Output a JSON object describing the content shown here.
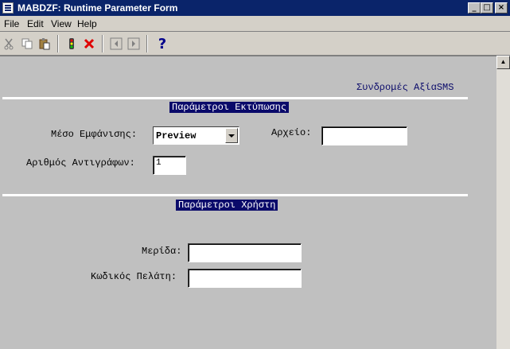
{
  "window": {
    "title": "MABDZF: Runtime Parameter Form"
  },
  "menu": {
    "file": "File",
    "edit": "Edit",
    "view": "View",
    "help": "Help"
  },
  "toolbar": {
    "help_label": "?"
  },
  "form": {
    "header": "Συνδρομές ΑξίαSMS",
    "print_section": "Παράμετροι Εκτύπωσης",
    "display_label": "Μέσο Εμφάνισης:",
    "display_value": "Preview",
    "file_label": "Αρχείο:",
    "file_value": "",
    "copies_label": "Αριθμός Αντιγράφων:",
    "copies_value": "1",
    "user_section": "Παράμετροι Χρήστη",
    "portion_label": "Μερίδα:",
    "portion_value": "",
    "customer_label": "Κωδικός Πελάτη:",
    "customer_value": ""
  }
}
